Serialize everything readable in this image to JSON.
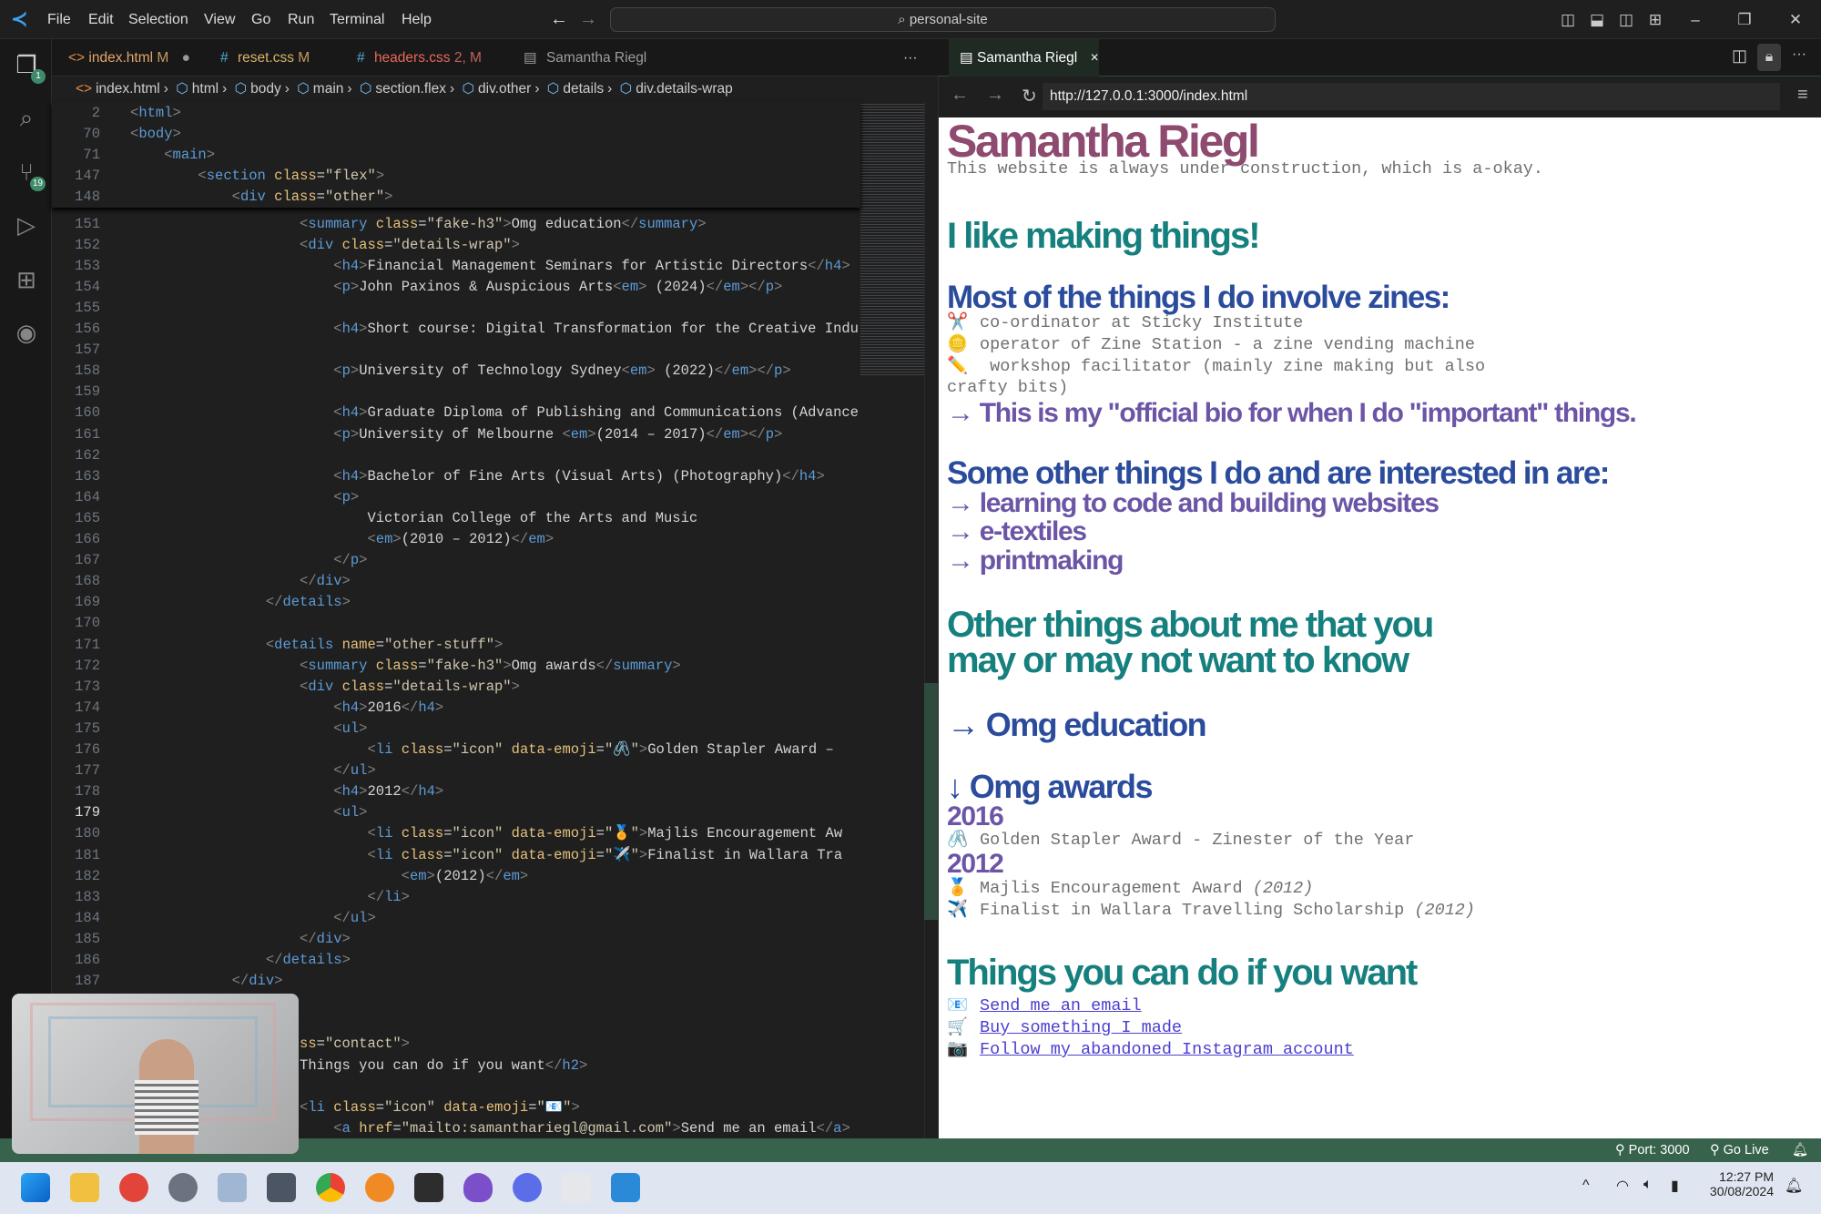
{
  "titlebar": {
    "menu": [
      "File",
      "Edit",
      "Selection",
      "View",
      "Go",
      "Run",
      "Terminal",
      "Help"
    ],
    "search": "personal-site"
  },
  "activity": {
    "explorer_badge": "1",
    "scm_badge": "19"
  },
  "tabs": [
    {
      "icon": "<>",
      "label": "index.html",
      "status": "M",
      "dirty": "●",
      "color": "#e2a66b"
    },
    {
      "icon": "#",
      "label": "reset.css",
      "status": "M",
      "color": "#d8b36a"
    },
    {
      "icon": "#",
      "label": "headers.css",
      "status": "2, M",
      "color": "#e8685a"
    },
    {
      "icon": "▤",
      "label": "Samantha Riegl",
      "color": "#9d9d9d"
    }
  ],
  "tabs_more": "···",
  "breadcrumb": [
    "index.html",
    "html",
    "body",
    "main",
    "section.flex",
    "div.other",
    "details",
    "div.details-wrap"
  ],
  "editor": {
    "current_line": 179,
    "sticky": [
      {
        "n": 2,
        "c": "<html>"
      },
      {
        "n": 70,
        "c": "<body>"
      },
      {
        "n": 71,
        "c": "    <main>"
      },
      {
        "n": 147,
        "c": "        <section class=\"flex\">"
      },
      {
        "n": 148,
        "c": "            <div class=\"other\">"
      }
    ],
    "lines": [
      {
        "n": 151,
        "c": "                    <summary class=\"fake-h3\">Omg education</summary>"
      },
      {
        "n": 152,
        "c": "                    <div class=\"details-wrap\">"
      },
      {
        "n": 153,
        "c": "                        <h4>Financial Management Seminars for Artistic Directors</h4>"
      },
      {
        "n": 154,
        "c": "                        <p>John Paxinos & Auspicious Arts<em> (2024)</em></p>"
      },
      {
        "n": 155,
        "c": ""
      },
      {
        "n": 156,
        "c": "                        <h4>Short course: Digital Transformation for the Creative Indu"
      },
      {
        "n": 157,
        "c": ""
      },
      {
        "n": 158,
        "c": "                        <p>University of Technology Sydney<em> (2022)</em></p>"
      },
      {
        "n": 159,
        "c": ""
      },
      {
        "n": 160,
        "c": "                        <h4>Graduate Diploma of Publishing and Communications (Advance"
      },
      {
        "n": 161,
        "c": "                        <p>University of Melbourne <em>(2014 – 2017)</em></p>"
      },
      {
        "n": 162,
        "c": ""
      },
      {
        "n": 163,
        "c": "                        <h4>Bachelor of Fine Arts (Visual Arts) (Photography)</h4>"
      },
      {
        "n": 164,
        "c": "                        <p>"
      },
      {
        "n": 165,
        "c": "                            Victorian College of the Arts and Music"
      },
      {
        "n": 166,
        "c": "                            <em>(2010 – 2012)</em>"
      },
      {
        "n": 167,
        "c": "                        </p>"
      },
      {
        "n": 168,
        "c": "                    </div>"
      },
      {
        "n": 169,
        "c": "                </details>"
      },
      {
        "n": 170,
        "c": ""
      },
      {
        "n": 171,
        "c": "                <details name=\"other-stuff\">"
      },
      {
        "n": 172,
        "c": "                    <summary class=\"fake-h3\">Omg awards</summary>"
      },
      {
        "n": 173,
        "c": "                    <div class=\"details-wrap\">"
      },
      {
        "n": 174,
        "c": "                        <h4>2016</h4>"
      },
      {
        "n": 175,
        "c": "                        <ul>"
      },
      {
        "n": 176,
        "c": "                            <li class=\"icon\" data-emoji=\"🖇️\">Golden Stapler Award –"
      },
      {
        "n": 177,
        "c": "                        </ul>"
      },
      {
        "n": 178,
        "c": "                        <h4>2012</h4>"
      },
      {
        "n": 179,
        "c": "                        <ul>"
      },
      {
        "n": 180,
        "c": "                            <li class=\"icon\" data-emoji=\"🏅\">Majlis Encouragement Aw"
      },
      {
        "n": 181,
        "c": "                            <li class=\"icon\" data-emoji=\"✈️\">Finalist in Wallara Tra"
      },
      {
        "n": 182,
        "c": "                                <em>(2012)</em>"
      },
      {
        "n": 183,
        "c": "                            </li>"
      },
      {
        "n": 184,
        "c": "                        </ul>"
      },
      {
        "n": 185,
        "c": "                    </div>"
      },
      {
        "n": 186,
        "c": "                </details>"
      },
      {
        "n": 187,
        "c": "            </div>"
      },
      {
        "n": null,
        "c": ""
      },
      {
        "n": null,
        "c": ""
      },
      {
        "n": null,
        "c": "                    ss=\"contact\">"
      },
      {
        "n": null,
        "c": "                    Things you can do if you want</h2>"
      },
      {
        "n": null,
        "c": ""
      },
      {
        "n": null,
        "c": "                    <li class=\"icon\" data-emoji=\"📧\">"
      },
      {
        "n": null,
        "c": "                        <a href=\"mailto:samanthariegl@gmail.com\">Send me an email</a>"
      }
    ]
  },
  "browser": {
    "tab": "Samantha Riegl",
    "close": "×",
    "url": "http://127.0.0.1:3000/index.html",
    "page": {
      "name": "Samantha Riegl",
      "tagline": "This website is always under construction, which is a-okay.",
      "h_making": "I like making things!",
      "h_zines": "Most of the things I do involve zines:",
      "zines": [
        {
          "icon": "✂️",
          "text": "co-ordinator at Sticky Institute"
        },
        {
          "icon": "🪙",
          "text": "operator of Zine Station - a zine vending machine"
        },
        {
          "icon": "✏️",
          "text": " workshop facilitator (mainly zine making but also"
        }
      ],
      "zines_wrap": "crafty bits)",
      "bio": "→ This is my \"official bio for when I do \"important\" things.",
      "h_other": "Some other things I do and are interested in are:",
      "interests": [
        "→ learning to code and building websites",
        "→ e-textiles",
        "→ printmaking"
      ],
      "h_about1": "Other things about me that you",
      "h_about2": "may or may not want to know",
      "education": "→ Omg education",
      "awards": "↓ Omg awards",
      "y2016": "2016",
      "a2016": {
        "icon": "🖇️",
        "text": "Golden Stapler Award - Zinester of the Year"
      },
      "y2012": "2012",
      "a2012": [
        {
          "icon": "🏅",
          "text": "Majlis Encouragement Award ",
          "year": "(2012)"
        },
        {
          "icon": "✈️",
          "text": "Finalist in Wallara Travelling Scholarship ",
          "year": "(2012)"
        }
      ],
      "h_things": "Things you can do if you want",
      "links": [
        {
          "icon": "📧",
          "text": "Send me an email"
        },
        {
          "icon": "🛒",
          "text": "Buy something I made"
        },
        {
          "icon": "📷",
          "text": "Follow my abandoned Instagram account"
        }
      ],
      "colors": {
        "name": "#8e4a6f",
        "teal": "#16807f",
        "blue": "#2b4c9c",
        "purple": "#6c55a6"
      }
    }
  },
  "status": {
    "port": "Port: 3000",
    "golive": "Go Live"
  },
  "taskbar": {
    "time": "12:27 PM",
    "date": "30/08/2024"
  }
}
